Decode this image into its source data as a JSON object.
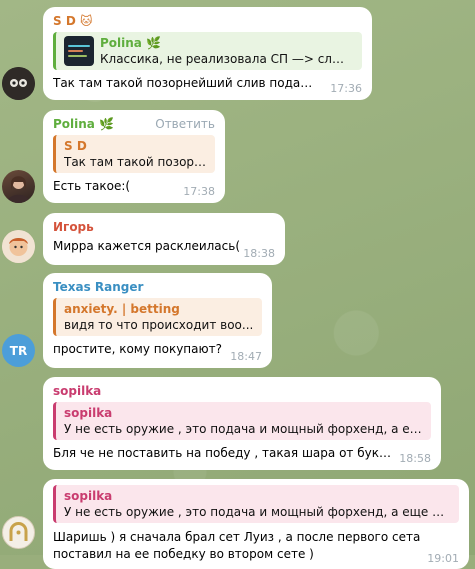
{
  "messages": [
    {
      "sender": "S D",
      "sender_badge": "🐱",
      "quote_name": "Polina",
      "quote_name_badge": "🌿",
      "quote_text": "Классика, не реализовала СП —> слила ...",
      "text": "Так там такой позорнейший слив подачи...",
      "time": "17:36"
    },
    {
      "sender": "Polina",
      "sender_badge": "🌿",
      "reply_action": "Ответить",
      "quote_name": "S D",
      "quote_text": "Так там такой позорн...",
      "text": "Есть такое:(",
      "time": "17:38"
    },
    {
      "sender": "Игорь",
      "text": "Мирра кажется расклеилась(",
      "time": "18:38"
    },
    {
      "sender": "Texas Ranger",
      "avatar_initials": "TR",
      "quote_name": "anxiety. | betting",
      "quote_text": "видя то что происходит воо...",
      "text": "простите, кому покупают?",
      "time": "18:47"
    },
    {
      "sender": "sopilka",
      "quote_name": "sopilka",
      "quote_text": "У не есть оружие , это подача и мощный форхенд, а ещ...",
      "text": "Бля че не поставить на победу , такая шара от буков )",
      "time": "18:58"
    },
    {
      "quote_name": "sopilka",
      "quote_text": "У не есть оружие , это подача и мощный форхенд, а еще три...",
      "text_line1": "Шаришь ) я сначала брал сет Луиз , а после первого сета",
      "text_line2": "поставил на ее победку во втором сете )",
      "time": "19:01"
    }
  ],
  "colors": {
    "sd": "#d4772c",
    "polina": "#5fae3e",
    "igor": "#d4533b",
    "texas": "#3a8fc2",
    "anxiety": "#d4772c",
    "sopilka": "#c93c6f"
  }
}
